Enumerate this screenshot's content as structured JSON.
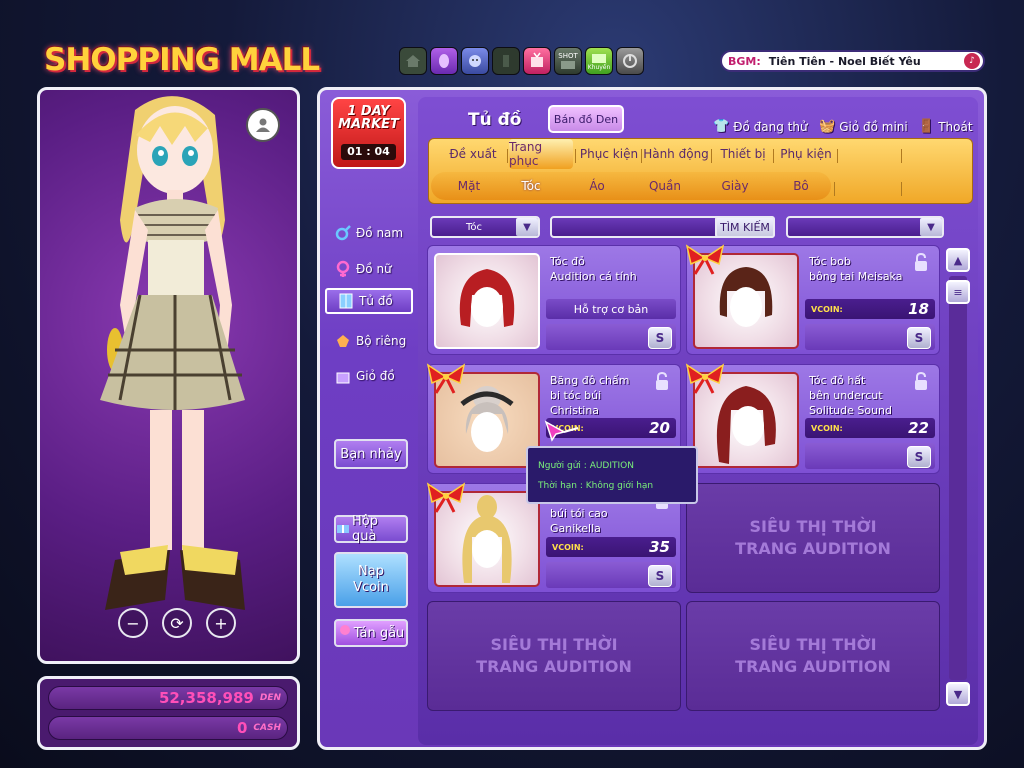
{
  "logo": {
    "text": "SHOPPING MALL"
  },
  "top_icons": [
    "home-icon",
    "skin-icon",
    "face-icon",
    "body-icon",
    "gift-tv-icon",
    "shot-icon",
    "khuyen-mai-icon",
    "exit-icon"
  ],
  "top_icon_labels": {
    "shot": "SHOT",
    "promo": "Khuyến"
  },
  "bgm": {
    "label": "BGM:",
    "song": "Tiên Tiên - Noel Biết Yêu"
  },
  "money": {
    "den_value": "52,358,989",
    "den_unit": "DEN",
    "cash_value": "0",
    "cash_unit": "CASH"
  },
  "one_day": {
    "title_line1": "1 DAY",
    "title_line2": "MARKET",
    "timer": "01 : 04"
  },
  "side_menu": {
    "male": "Đồ nam",
    "female": "Đồ nữ",
    "closet": "Tủ đồ",
    "set": "Bộ riêng",
    "basket": "Giỏ đồ",
    "dancer": "Bạn nhảy",
    "gift_box": "Hộp quà",
    "topup_line1": "Nạp",
    "topup_line2": "Vcoin",
    "chat": "Tán gẫu"
  },
  "header": {
    "title": "Tủ đồ",
    "sell_button": "Bán đồ Den",
    "trying": "Đồ đang thử",
    "mini_basket": "Giỏ đồ mini",
    "exit": "Thoát"
  },
  "tabs": [
    "Đề xuất",
    "Trang phục",
    "Phục kiện",
    "Hành động",
    "Thiết bị",
    "Phụ kiện"
  ],
  "active_tab": "Trang phục",
  "subtabs": [
    "Mặt",
    "Tóc",
    "Áo",
    "Quần",
    "Giày",
    "Bô"
  ],
  "active_subtab": "Tóc",
  "filter": {
    "category": "Tóc",
    "search_button": "TÌM KIẾM"
  },
  "items": [
    {
      "name_line1": "Tóc đỏ",
      "name_line2": "Audition cá tính",
      "name_line3": "",
      "support": "Hỗ trợ cơ bản",
      "vcoin_label": "",
      "price": "",
      "hair_color": "#b81e22",
      "locked": false,
      "gift": false
    },
    {
      "name_line1": "Tóc bob",
      "name_line2": "bông tai Meisaka",
      "name_line3": "",
      "support": "",
      "vcoin_label": "VCOIN:",
      "price": "18",
      "hair_color": "#5a2418",
      "locked": true,
      "gift": true
    },
    {
      "name_line1": "Băng đô chấm",
      "name_line2": "bi tóc búi",
      "name_line3": "Christina",
      "support": "",
      "vcoin_label": "VCOIN:",
      "price": "20",
      "hair_color": "#d8d0cc",
      "locked": true,
      "gift": true
    },
    {
      "name_line1": "Tóc đỏ hất",
      "name_line2": "bên undercut",
      "name_line3": "Solitude Sound",
      "support": "",
      "vcoin_label": "VCOIN:",
      "price": "22",
      "hair_color": "#8a1e1e",
      "locked": true,
      "gift": true
    },
    {
      "name_line1": "",
      "name_line2": "búi tói cao",
      "name_line3": "Ganikella",
      "support": "",
      "vcoin_label": "VCOIN:",
      "price": "35",
      "hair_color": "#e8c86e",
      "locked": true,
      "gift": true
    }
  ],
  "buy_label": "S",
  "empty_slot": {
    "line1": "SIÊU THỊ THỜI",
    "line2": "TRANG AUDITION"
  },
  "tooltip": {
    "sender": "Người gửi : AUDITION",
    "duration": "Thời hạn : Không giới hạn"
  },
  "colors": {
    "accent": "#7e4ed2",
    "tab_gold": "#f0a828",
    "price_text": "#ffffff",
    "den_pink": "#ff4fb8"
  }
}
